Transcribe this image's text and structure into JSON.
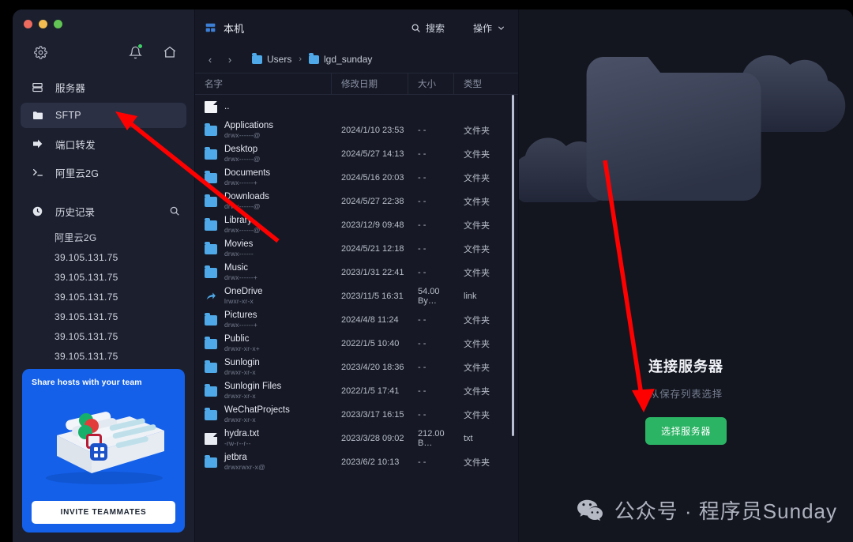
{
  "window": {
    "traffic_lights": [
      "close",
      "minimize",
      "maximize"
    ]
  },
  "sidebar": {
    "top_icons": [
      {
        "name": "gear-icon",
        "glyph": "settings"
      },
      {
        "name": "bell-icon",
        "glyph": "bell",
        "badge": true
      },
      {
        "name": "home-icon",
        "glyph": "home"
      }
    ],
    "nav": [
      {
        "label": "服务器",
        "icon": "server-icon",
        "active": false
      },
      {
        "label": "SFTP",
        "icon": "folder-icon",
        "active": true
      },
      {
        "label": "端口转发",
        "icon": "port-forward-icon",
        "active": false
      },
      {
        "label": "阿里云2G",
        "icon": "terminal-icon",
        "active": false
      }
    ],
    "history": {
      "label": "历史记录",
      "icon": "clock-icon",
      "search_icon": "search-icon",
      "items": [
        "阿里云2G",
        "39.105.131.75",
        "39.105.131.75",
        "39.105.131.75",
        "39.105.131.75",
        "39.105.131.75",
        "39.105.131.75"
      ]
    },
    "promo": {
      "title": "Share hosts with your team",
      "button": "INVITE TEAMMATES",
      "bg_color": "#1460E8"
    }
  },
  "file_panel": {
    "machine_label": "本机",
    "machine_icon": "grid-icon",
    "search_label": "搜索",
    "search_icon": "search-icon",
    "actions_label": "操作",
    "actions_icon": "chevron-down-icon",
    "nav_back_icon": "chevron-left-icon",
    "nav_forward_icon": "chevron-right-icon",
    "breadcrumb": [
      "Users",
      "lgd_sunday"
    ],
    "columns": [
      "名字",
      "修改日期",
      "大小",
      "类型"
    ],
    "rows": [
      {
        "name": "..",
        "perm": "",
        "date": "",
        "size": "",
        "type": "",
        "icon": "document-icon"
      },
      {
        "name": "Applications",
        "perm": "drwx------@",
        "date": "2024/1/10 23:53",
        "size": "- -",
        "type": "文件夹",
        "icon": "folder-icon"
      },
      {
        "name": "Desktop",
        "perm": "drwx------@",
        "date": "2024/5/27 14:13",
        "size": "- -",
        "type": "文件夹",
        "icon": "folder-icon"
      },
      {
        "name": "Documents",
        "perm": "drwx------+",
        "date": "2024/5/16 20:03",
        "size": "- -",
        "type": "文件夹",
        "icon": "folder-icon"
      },
      {
        "name": "Downloads",
        "perm": "drwx------@",
        "date": "2024/5/27 22:38",
        "size": "- -",
        "type": "文件夹",
        "icon": "folder-icon"
      },
      {
        "name": "Library",
        "perm": "drwx------@",
        "date": "2023/12/9 09:48",
        "size": "- -",
        "type": "文件夹",
        "icon": "folder-icon"
      },
      {
        "name": "Movies",
        "perm": "drwx------",
        "date": "2024/5/21 12:18",
        "size": "- -",
        "type": "文件夹",
        "icon": "folder-icon"
      },
      {
        "name": "Music",
        "perm": "drwx------+",
        "date": "2023/1/31 22:41",
        "size": "- -",
        "type": "文件夹",
        "icon": "folder-icon"
      },
      {
        "name": "OneDrive",
        "perm": "lrwxr-xr-x",
        "date": "2023/11/5 16:31",
        "size": "54.00 By…",
        "type": "link",
        "icon": "link-icon"
      },
      {
        "name": "Pictures",
        "perm": "drwx------+",
        "date": "2024/4/8 11:24",
        "size": "- -",
        "type": "文件夹",
        "icon": "folder-icon"
      },
      {
        "name": "Public",
        "perm": "drwxr-xr-x+",
        "date": "2022/1/5 10:40",
        "size": "- -",
        "type": "文件夹",
        "icon": "folder-icon"
      },
      {
        "name": "Sunlogin",
        "perm": "drwxr-xr-x",
        "date": "2023/4/20 18:36",
        "size": "- -",
        "type": "文件夹",
        "icon": "folder-icon"
      },
      {
        "name": "Sunlogin Files",
        "perm": "drwxr-xr-x",
        "date": "2022/1/5 17:41",
        "size": "- -",
        "type": "文件夹",
        "icon": "folder-icon"
      },
      {
        "name": "WeChatProjects",
        "perm": "drwxr-xr-x",
        "date": "2023/3/17 16:15",
        "size": "- -",
        "type": "文件夹",
        "icon": "folder-icon"
      },
      {
        "name": "hydra.txt",
        "perm": "-rw-r--r--",
        "date": "2023/3/28 09:02",
        "size": "212.00 B…",
        "type": "txt",
        "icon": "text-file-icon"
      },
      {
        "name": "jetbra",
        "perm": "drwxrwxr-x@",
        "date": "2023/6/2 10:13",
        "size": "- -",
        "type": "文件夹",
        "icon": "folder-icon"
      }
    ]
  },
  "right_panel": {
    "title": "连接服务器",
    "subtitle": "从保存列表选择",
    "button": "选择服务器",
    "button_color": "#2BB464",
    "illustration": "cloud-folder-illustration",
    "watermark": {
      "icon": "wechat-icon",
      "text": "公众号 · 程序员Sunday"
    }
  },
  "annotations": {
    "arrow_color": "#FF0000",
    "arrows": [
      "arrow-to-sftp",
      "arrow-to-select-server"
    ]
  }
}
